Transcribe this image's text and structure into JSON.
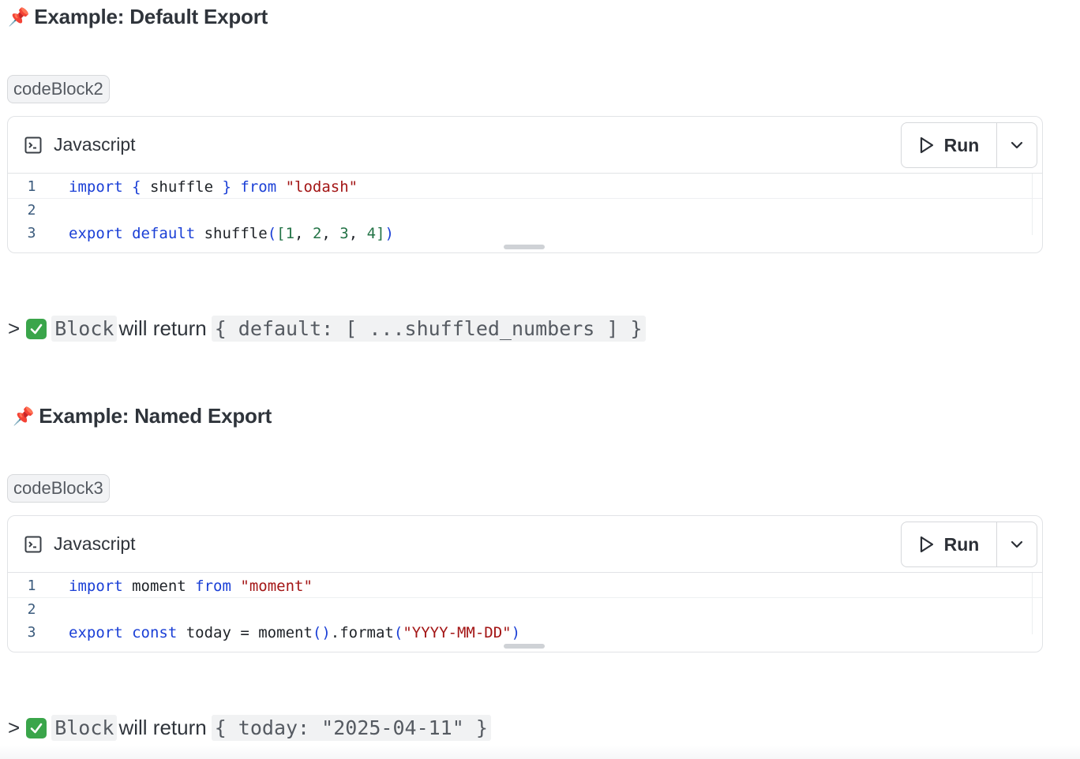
{
  "sections": [
    {
      "heading": "Example: Default Export",
      "tag": "codeBlock2",
      "language": "Javascript",
      "run_label": "Run",
      "code_lines": [
        {
          "n": "1"
        },
        {
          "n": "2"
        },
        {
          "n": "3"
        }
      ],
      "code": {
        "l1": [
          "import",
          " { ",
          "shuffle",
          " } ",
          "from",
          " ",
          "\"lodash\""
        ],
        "l3": [
          "export",
          " ",
          "default",
          " shuffle",
          "(",
          "[",
          "1",
          ", ",
          "2",
          ", ",
          "3",
          ", ",
          "4",
          "]",
          ")"
        ]
      },
      "result": {
        "prefix": ">",
        "block": "Block",
        "text": "will return",
        "value": "{ default: [ ...shuffled_numbers ] }"
      }
    },
    {
      "heading": "Example: Named Export",
      "tag": "codeBlock3",
      "language": "Javascript",
      "run_label": "Run",
      "code_lines": [
        {
          "n": "1"
        },
        {
          "n": "2"
        },
        {
          "n": "3"
        }
      ],
      "code": {
        "l1": [
          "import",
          " moment ",
          "from",
          " ",
          "\"moment\""
        ],
        "l3": [
          "export",
          " ",
          "const",
          " today = moment",
          "(",
          ")",
          ".format",
          "(",
          "\"YYYY-MM-DD\"",
          ")"
        ]
      },
      "result": {
        "prefix": ">",
        "block": "Block",
        "text": "will return",
        "value": "{ today: \"2025-04-11\" }"
      }
    }
  ],
  "icons": {
    "pin": "pushpin-icon",
    "terminal": "terminal-icon",
    "play": "play-icon",
    "chevron": "chevron-down-icon",
    "check": "check-mark-icon"
  },
  "colors": {
    "keyword": "#1a3fd6",
    "string": "#a31515",
    "number": "#237346",
    "check": "#3aa54a"
  }
}
